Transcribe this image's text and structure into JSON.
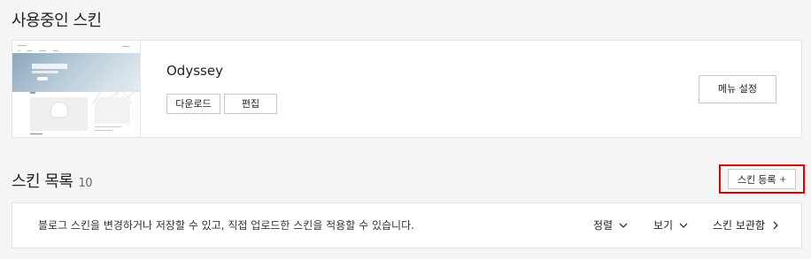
{
  "current_section": {
    "title": "사용중인 스킨"
  },
  "current_skin": {
    "name": "Odyssey",
    "download_label": "다운로드",
    "edit_label": "편집",
    "menu_settings_label": "메뉴 설정"
  },
  "list_section": {
    "title": "스킨 목록",
    "count": "10",
    "register_label": "스킨 등록",
    "register_icon": "plus-icon"
  },
  "list_bar": {
    "description": "블로그 스킨을 변경하거나 저장할 수 있고, 직접 업로드한 스킨을 적용할 수 있습니다.",
    "sort_label": "정렬",
    "view_label": "보기",
    "archive_label": "스킨 보관함"
  },
  "colors": {
    "highlight_border": "#e00000",
    "page_background": "#f5f5f5"
  }
}
